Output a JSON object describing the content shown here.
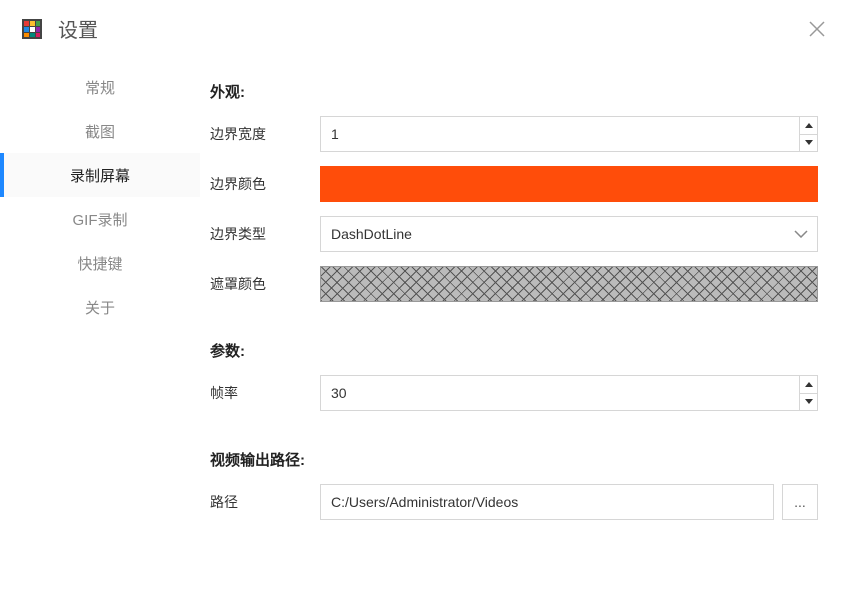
{
  "window": {
    "title": "设置"
  },
  "sidebar": {
    "items": [
      {
        "label": "常规"
      },
      {
        "label": "截图"
      },
      {
        "label": "录制屏幕"
      },
      {
        "label": "GIF录制"
      },
      {
        "label": "快捷键"
      },
      {
        "label": "关于"
      }
    ],
    "active_index": 2
  },
  "sections": {
    "appearance": {
      "title": "外观:",
      "border_width_label": "边界宽度",
      "border_width_value": "1",
      "border_color_label": "边界颜色",
      "border_color_value": "#ff4d0a",
      "border_type_label": "边界类型",
      "border_type_value": "DashDotLine",
      "mask_color_label": "遮罩颜色",
      "mask_color_value": "crosshatch-gray"
    },
    "params": {
      "title": "参数:",
      "fps_label": "帧率",
      "fps_value": "30"
    },
    "output": {
      "title": "视频输出路径:",
      "path_label": "路径",
      "path_value": "C:/Users/Administrator/Videos",
      "browse_label": "..."
    }
  }
}
